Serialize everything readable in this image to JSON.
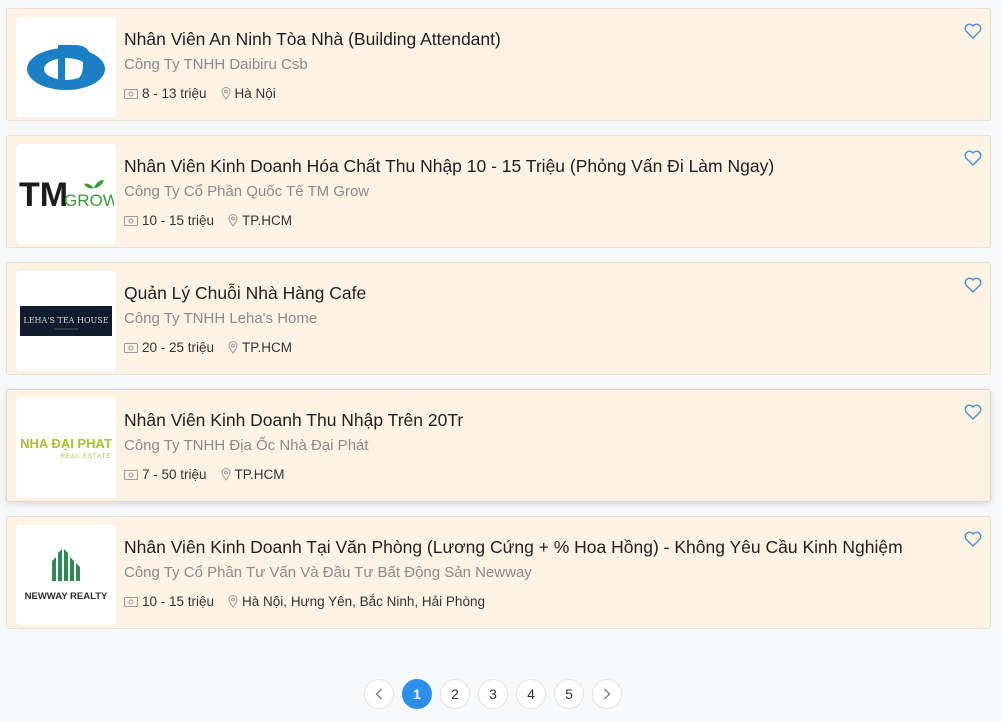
{
  "jobs": [
    {
      "title": "Nhân Viên An Ninh Tòa Nhà (Building Attendant)",
      "company": "Công Ty TNHH Daibiru Csb",
      "salary": "8 - 13 triệu",
      "location": "Hà Nội",
      "logo": {
        "text": "",
        "icon": "daibiru-logo"
      }
    },
    {
      "title": "Nhân Viên Kinh Doanh Hóa Chất Thu Nhập 10 - 15 Triệu (Phỏng Vấn Đi Làm Ngay)",
      "company": "Công Ty Cổ Phần Quốc Tế TM Grow",
      "salary": "10 - 15 triệu",
      "location": "TP.HCM",
      "logo": {
        "text": "TM",
        "text2": "GROW",
        "icon": "tm-grow-logo"
      }
    },
    {
      "title": "Quản Lý Chuỗi Nhà Hàng Cafe",
      "company": "Công Ty TNHH Leha's Home",
      "salary": "20 - 25 triệu",
      "location": "TP.HCM",
      "logo": {
        "text": "LEHA'S TEA HOUSE",
        "icon": "lehas-tea-house-logo"
      }
    },
    {
      "title": "Nhân Viên Kinh Doanh Thu Nhập Trên 20Tr",
      "company": "Công Ty TNHH Địa Ốc Nhà Đại Phát",
      "salary": "7 - 50 triệu",
      "location": "TP.HCM",
      "logo": {
        "text": "NHA ĐẠI PHAT",
        "text2": "REAL ESTATE",
        "icon": "nha-dai-phat-logo"
      }
    },
    {
      "title": "Nhân Viên Kinh Doanh Tại Văn Phòng (Lương Cứng + % Hoa Hồng) - Không Yêu Cầu Kinh Nghiệm",
      "company": "Công Ty Cổ Phần Tư Vấn Và Đầu Tư Bất Động Sản Newway",
      "salary": "10 - 15 triệu",
      "location": "Hà Nội, Hưng Yên, Bắc Ninh, Hải Phòng",
      "logo": {
        "text": "NEWWAY REALTY",
        "icon": "newway-realty-logo"
      }
    }
  ],
  "pagination": {
    "prev_icon": "chevron-left-icon",
    "next_icon": "chevron-right-icon",
    "pages": [
      "1",
      "2",
      "3",
      "4",
      "5"
    ],
    "current": "1"
  },
  "colors": {
    "card_bg": "#fdf3e4",
    "accent": "#2d8fe8",
    "heart": "#4a90d9"
  }
}
